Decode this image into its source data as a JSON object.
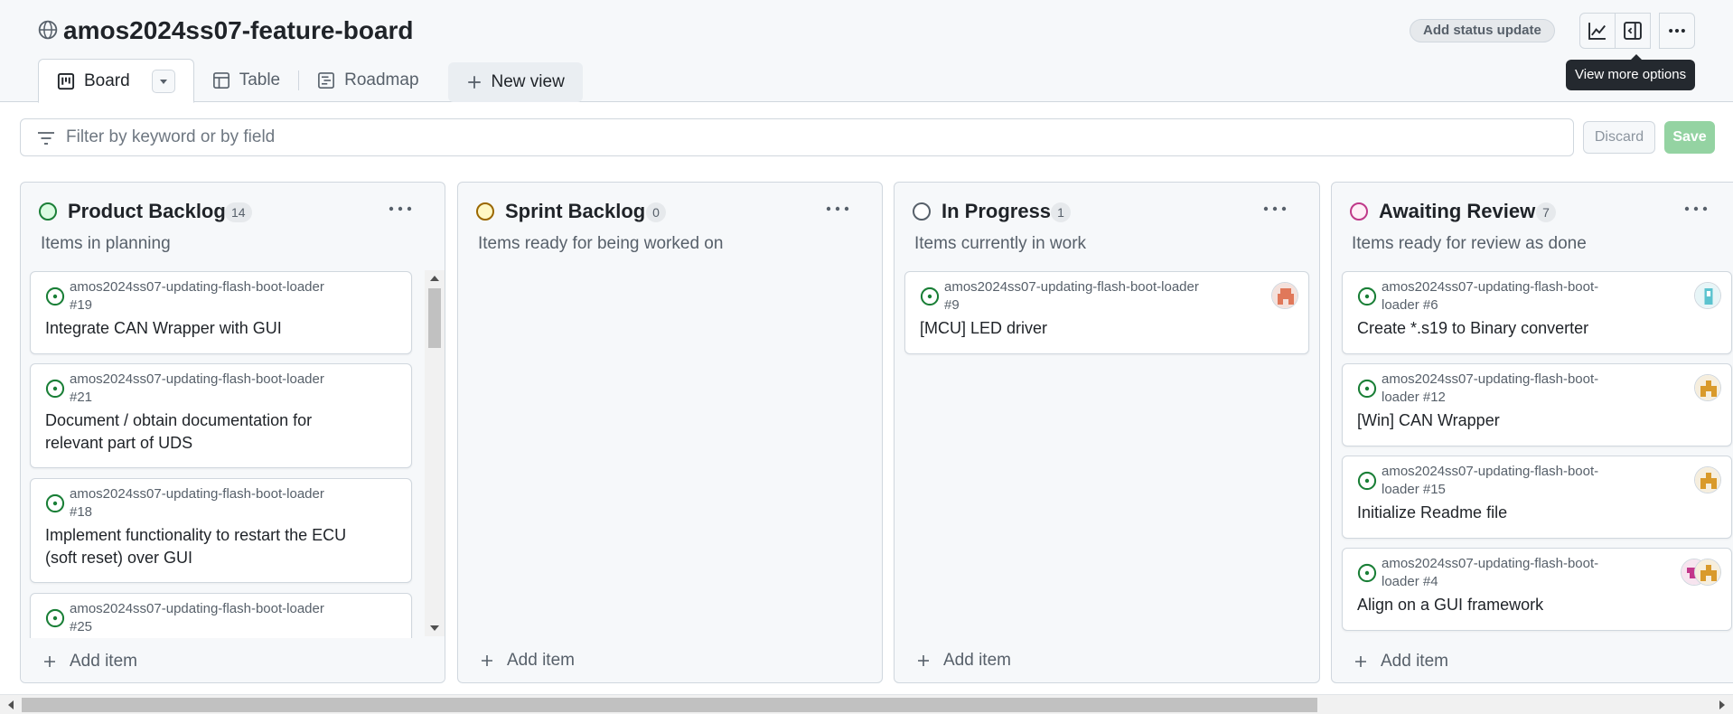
{
  "header": {
    "title": "amos2024ss07-feature-board",
    "status_button": "Add status update",
    "tooltip": "View more options"
  },
  "tabs": [
    {
      "label": "Board",
      "icon": "board-icon",
      "active": true
    },
    {
      "label": "Table",
      "icon": "table-icon"
    },
    {
      "label": "Roadmap",
      "icon": "roadmap-icon"
    },
    {
      "label": "New view",
      "icon": "plus-icon"
    }
  ],
  "filter": {
    "placeholder": "Filter by keyword or by field",
    "value": "",
    "discard_label": "Discard",
    "save_label": "Save"
  },
  "columns": [
    {
      "title": "Product Backlog",
      "count": "14",
      "description": "Items in planning",
      "dot_color": "#1a7f37",
      "dot_fill": "#dafbe1",
      "add_label": "Add item",
      "cards": [
        {
          "repo_line1": "amos2024ss07-updating-flash-boot-loader",
          "repo_line2": "#19",
          "title_line1": "Integrate CAN Wrapper with GUI",
          "title_line2": ""
        },
        {
          "repo_line1": "amos2024ss07-updating-flash-boot-loader",
          "repo_line2": "#21",
          "title_line1": "Document / obtain documentation for",
          "title_line2": "relevant part of UDS"
        },
        {
          "repo_line1": "amos2024ss07-updating-flash-boot-loader",
          "repo_line2": "#18",
          "title_line1": "Implement functionality to restart the ECU",
          "title_line2": "(soft reset) over GUI"
        },
        {
          "repo_line1": "amos2024ss07-updating-flash-boot-loader",
          "repo_line2": "#25",
          "title_line1": "",
          "title_line2": ""
        }
      ]
    },
    {
      "title": "Sprint Backlog",
      "count": "0",
      "description": "Items ready for being worked on",
      "dot_color": "#9a6700",
      "dot_fill": "#fff8c5",
      "add_label": "Add item",
      "cards": []
    },
    {
      "title": "In Progress",
      "count": "1",
      "description": "Items currently in work",
      "dot_color": "#57606a",
      "dot_fill": "#ffffff",
      "add_label": "Add item",
      "cards": [
        {
          "repo_line1": "amos2024ss07-updating-flash-boot-loader",
          "repo_line2": "#9",
          "title_line1": "[MCU] LED driver",
          "title_line2": ""
        }
      ]
    },
    {
      "title": "Awaiting Review",
      "count": "7",
      "description": "Items ready for review as done",
      "dot_color": "#bf3989",
      "dot_fill": "#ffeff7",
      "add_label": "Add item",
      "cards": [
        {
          "repo_line1": "amos2024ss07-updating-flash-boot-",
          "repo_line2": "loader #6",
          "title_line1": "Create *.s19 to Binary converter",
          "title_line2": ""
        },
        {
          "repo_line1": "amos2024ss07-updating-flash-boot-",
          "repo_line2": "loader #12",
          "title_line1": "[Win] CAN Wrapper",
          "title_line2": ""
        },
        {
          "repo_line1": "amos2024ss07-updating-flash-boot-",
          "repo_line2": "loader #15",
          "title_line1": "Initialize Readme file",
          "title_line2": ""
        },
        {
          "repo_line1": "amos2024ss07-updating-flash-boot-",
          "repo_line2": "loader #4",
          "title_line1": "Align on a GUI framework",
          "title_line2": ""
        }
      ]
    }
  ],
  "colors": {
    "open_issue": "#1a7f37",
    "save_disabled": "#94d3a2",
    "accent": "#0969da"
  }
}
